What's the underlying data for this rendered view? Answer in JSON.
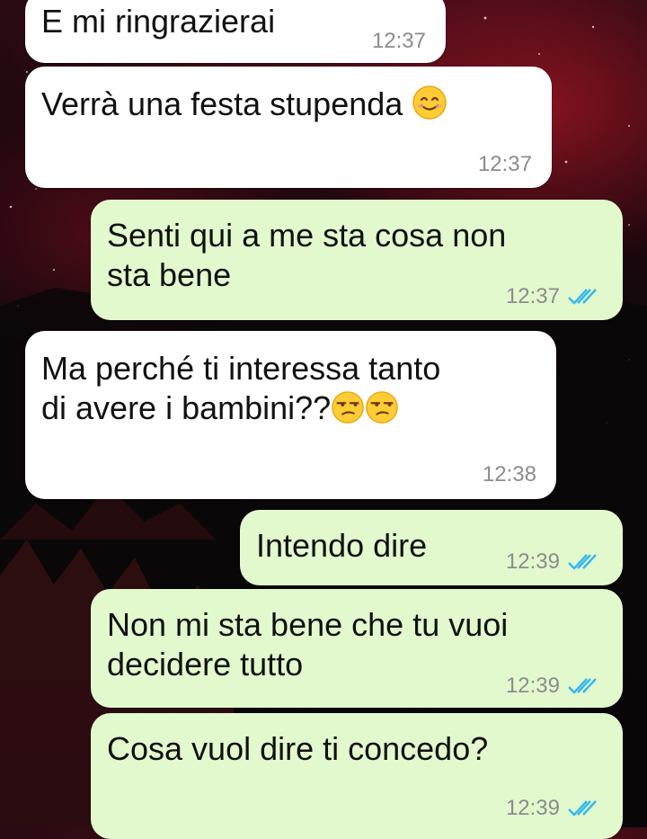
{
  "messages": [
    {
      "direction": "incoming",
      "text": "E mi ringrazierai",
      "time": "12:37"
    },
    {
      "direction": "incoming",
      "text": "Verrà una festa stupenda",
      "emoji": [
        "smiling-face-with-smiling-eyes"
      ],
      "time": "12:37"
    },
    {
      "direction": "outgoing",
      "lines": [
        "Senti qui a me sta cosa non",
        "sta bene"
      ],
      "time": "12:37",
      "read": true
    },
    {
      "direction": "incoming",
      "lines": [
        "Ma perché ti interessa tanto",
        "di avere i bambini??"
      ],
      "emoji": [
        "unamused-face",
        "unamused-face"
      ],
      "time": "12:38"
    },
    {
      "direction": "outgoing",
      "text": "Intendo dire",
      "time": "12:39",
      "read": true
    },
    {
      "direction": "outgoing",
      "lines": [
        "Non mi sta bene che tu vuoi",
        "decidere tutto"
      ],
      "time": "12:39",
      "read": true
    },
    {
      "direction": "outgoing",
      "text": "Cosa vuol dire ti concedo?",
      "time": "12:39",
      "read": true
    }
  ],
  "colors": {
    "incoming_bubble": "#ffffff",
    "outgoing_bubble": "#e2f9cd",
    "read_ticks": "#34b7f1",
    "timestamp": "#8c8c8c"
  }
}
